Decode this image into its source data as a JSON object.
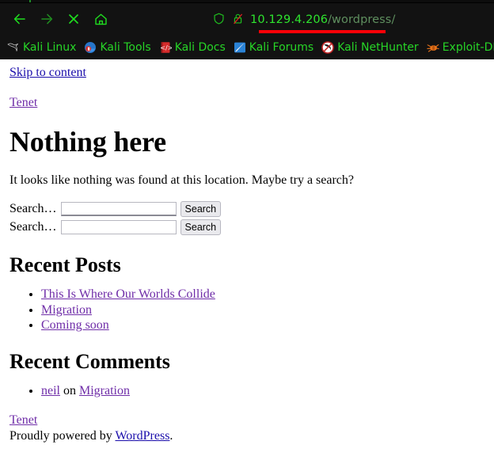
{
  "browser": {
    "nav": {
      "back_label": "Back",
      "forward_label": "Forward",
      "stop_label": "Stop",
      "home_label": "Home"
    },
    "url": {
      "host": "10.129.4.206",
      "path": "/wordpress/",
      "shield_label": "Tracking protection",
      "lock_label": "Connection is not secure",
      "highlight_color": "#fb0007",
      "host_color": "#2ee52e",
      "path_color": "#5f8f5f"
    },
    "bookmarks": [
      {
        "label": "Kali Linux",
        "icon": "kali-dragon-icon"
      },
      {
        "label": "Kali Tools",
        "icon": "kali-tools-icon"
      },
      {
        "label": "Kali Docs",
        "icon": "kali-docs-icon"
      },
      {
        "label": "Kali Forums",
        "icon": "kali-forums-icon"
      },
      {
        "label": "Kali NetHunter",
        "icon": "kali-nethunter-icon"
      },
      {
        "label": "Exploit-DB",
        "icon": "exploit-db-icon"
      }
    ]
  },
  "page": {
    "skip_link": "Skip to content",
    "site_title": "Tenet",
    "heading": "Nothing here",
    "not_found_text": "It looks like nothing was found at this location. Maybe try a search?",
    "search_forms": [
      {
        "label": "Search…",
        "value": "",
        "placeholder": "",
        "button": "Search"
      },
      {
        "label": "Search…",
        "value": "",
        "placeholder": "",
        "button": "Search"
      }
    ],
    "recent_posts": {
      "heading": "Recent Posts",
      "items": [
        "This Is Where Our Worlds Collide",
        "Migration",
        "Coming soon"
      ]
    },
    "recent_comments": {
      "heading": "Recent Comments",
      "items": [
        {
          "author": "neil",
          "connector": "on",
          "post": "Migration"
        }
      ]
    },
    "footer": {
      "site_link": "Tenet",
      "credit_prefix": "Proudly powered by",
      "credit_link": "WordPress",
      "credit_suffix": "."
    }
  }
}
